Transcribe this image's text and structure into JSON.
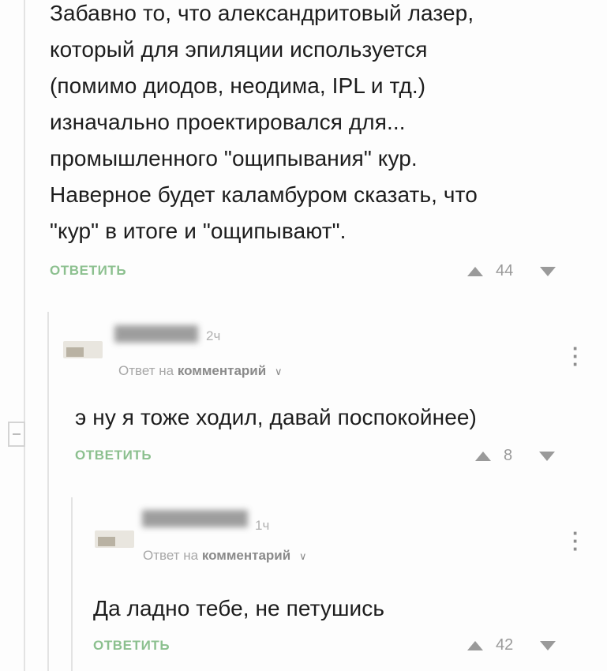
{
  "comments": [
    {
      "text": "Забавно то, что александритовый лазер,\nкоторый для эпиляции используется\n(помимо диодов, неодима, IPL и тд.)\nизначально проектировался для...\nпромышленного \"ощипывания\" кур.\nНаверное будет каламбуром сказать, что\n\"кур\" в итоге и \"ощипывают\".",
      "reply_label": "ОТВЕТИТЬ",
      "rating": "44"
    },
    {
      "time": "2ч",
      "reply_to_prefix": "Ответ на",
      "reply_to_target": "комментарий",
      "text": "э ну я тоже ходил, давай поспокойнее)",
      "reply_label": "ОТВЕТИТЬ",
      "rating": "8"
    },
    {
      "time": "1ч",
      "reply_to_prefix": "Ответ на",
      "reply_to_target": "комментарий",
      "text": "Да ладно тебе, не петушись",
      "reply_label": "ОТВЕТИТЬ",
      "rating": "42"
    }
  ],
  "icons": {
    "more": "vertical-dots",
    "upvote": "triangle-up",
    "downvote": "triangle-down",
    "collapse": "minus-box",
    "dropdown": "chevron-down"
  },
  "colors": {
    "reply_link": "#8cc08f",
    "vote": "#9a9a9a",
    "thread_line": "#e3e3e3"
  }
}
